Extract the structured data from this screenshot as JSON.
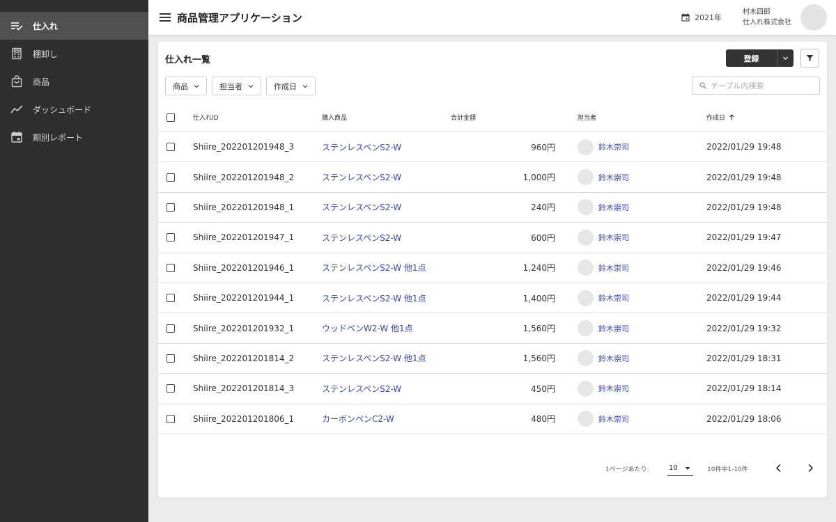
{
  "sidebar": {
    "items": [
      {
        "label": "仕入れ",
        "icon": "list-check-icon",
        "active": true
      },
      {
        "label": "棚卸し",
        "icon": "calculator-icon",
        "active": false
      },
      {
        "label": "商品",
        "icon": "shopping-bag-icon",
        "active": false
      },
      {
        "label": "ダッシュボード",
        "icon": "trending-line-icon",
        "active": false
      },
      {
        "label": "期別レポート",
        "icon": "calendar-icon",
        "active": false
      }
    ]
  },
  "header": {
    "title": "商品管理アプリケーション",
    "year": "2021年",
    "user_name": "村木四郎",
    "company": "仕入れ株式会社"
  },
  "main": {
    "title": "仕入れ一覧",
    "register_label": "登録",
    "filters": [
      "商品",
      "担当者",
      "作成日"
    ],
    "search_placeholder": "テーブル内検索",
    "columns": {
      "id": "仕入れID",
      "product": "購入商品",
      "amount": "合計金額",
      "staff": "担当者",
      "date": "作成日"
    },
    "rows": [
      {
        "id": "Shiire_202201201948_3",
        "product": "ステンレスペンS2-W",
        "amount": "960円",
        "staff": "鈴木崇司",
        "date": "2022/01/29 19:48"
      },
      {
        "id": "Shiire_202201201948_2",
        "product": "ステンレスペンS2-W",
        "amount": "1,000円",
        "staff": "鈴木崇司",
        "date": "2022/01/29 19:48"
      },
      {
        "id": "Shiire_202201201948_1",
        "product": "ステンレスペンS2-W",
        "amount": "240円",
        "staff": "鈴木崇司",
        "date": "2022/01/29 19:48"
      },
      {
        "id": "Shiire_202201201947_1",
        "product": "ステンレスペンS2-W",
        "amount": "600円",
        "staff": "鈴木崇司",
        "date": "2022/01/29 19:47"
      },
      {
        "id": "Shiire_202201201946_1",
        "product": "ステンレスペンS2-W 他1点",
        "amount": "1,240円",
        "staff": "鈴木崇司",
        "date": "2022/01/29 19:46"
      },
      {
        "id": "Shiire_202201201944_1",
        "product": "ステンレスペンS2-W 他1点",
        "amount": "1,400円",
        "staff": "鈴木崇司",
        "date": "2022/01/29 19:44"
      },
      {
        "id": "Shiire_202201201932_1",
        "product": "ウッドペンW2-W 他1点",
        "amount": "1,560円",
        "staff": "鈴木崇司",
        "date": "2022/01/29 19:32"
      },
      {
        "id": "Shiire_202201201814_2",
        "product": "ステンレスペンS2-W 他1点",
        "amount": "1,560円",
        "staff": "鈴木崇司",
        "date": "2022/01/29 18:31"
      },
      {
        "id": "Shiire_202201201814_3",
        "product": "ステンレスペンS2-W",
        "amount": "450円",
        "staff": "鈴木崇司",
        "date": "2022/01/29 18:14"
      },
      {
        "id": "Shiire_202201201806_1",
        "product": "カーボンペンC2-W",
        "amount": "480円",
        "staff": "鈴木崇司",
        "date": "2022/01/29 18:06"
      }
    ]
  },
  "pagination": {
    "per_page_label": "1ページあたり:",
    "per_page_value": "10",
    "range": "10件中1-10件"
  },
  "colors": {
    "sidebar_bg": "#2e2e2e",
    "sidebar_active": "#505050",
    "link": "#3344bb",
    "button": "#333333"
  }
}
